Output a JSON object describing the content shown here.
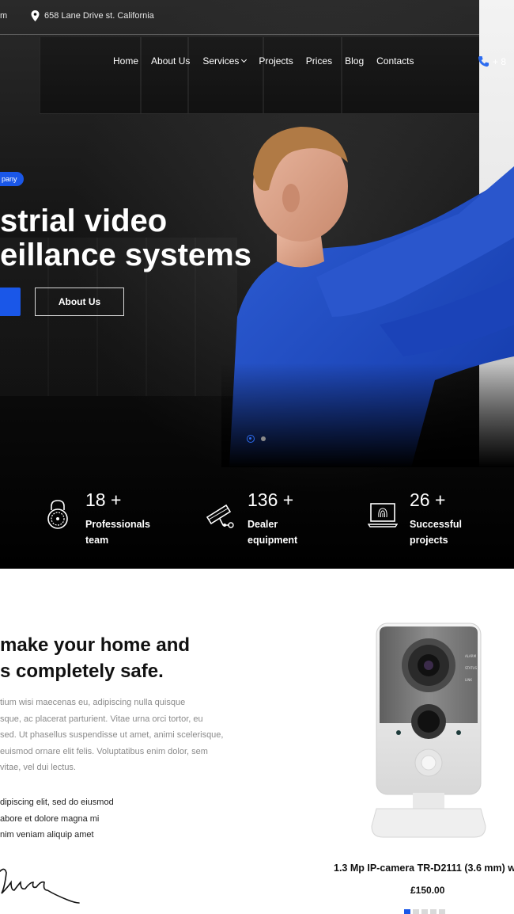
{
  "topbar": {
    "email_fragment": "m",
    "address": "658 Lane Drive st. California"
  },
  "nav": {
    "items": [
      {
        "label": "Home"
      },
      {
        "label": "About Us"
      },
      {
        "label": "Services"
      },
      {
        "label": "Projects"
      },
      {
        "label": "Prices"
      },
      {
        "label": "Blog"
      },
      {
        "label": "Contacts"
      }
    ],
    "phone": "+ 8"
  },
  "hero": {
    "badge": "pany",
    "title_line1": "strial video",
    "title_line2": "eillance systems",
    "button_secondary": "About Us",
    "slides": 2,
    "active_slide": 1
  },
  "stats": [
    {
      "icon": "lock-icon",
      "number": "18 +",
      "label_line1": "Professionals",
      "label_line2": "team"
    },
    {
      "icon": "cctv-camera-icon",
      "number": "136 +",
      "label_line1": "Dealer",
      "label_line2": "equipment"
    },
    {
      "icon": "fingerprint-laptop-icon",
      "number": "26 +",
      "label_line1": "Successful",
      "label_line2": "projects"
    }
  ],
  "content": {
    "heading_line1": "make your home and",
    "heading_line2": "s completely safe.",
    "paragraph_lines": [
      "tium wisi maecenas eu, adipiscing nulla quisque",
      "sque, ac placerat parturient. Vitae urna orci tortor, eu",
      " sed. Ut phasellus suspendisse ut amet, animi scelerisque,",
      " euismod ornare elit felis. Voluptatibus enim dolor, sem",
      "vitae, vel dui lectus."
    ],
    "list_lines": [
      "dipiscing elit, sed do eiusmod",
      "abore et dolore magna mi",
      "nim veniam aliquip amet"
    ]
  },
  "product": {
    "name": "1.3 Mp IP-camera TR-D2111 (3.6 mm) w",
    "price": "£150.00",
    "rating_marks": 5,
    "rating_active": 1
  },
  "colors": {
    "accent": "#1a57e8",
    "hero_bg": "#000000",
    "text_muted": "#8a8a8a"
  }
}
